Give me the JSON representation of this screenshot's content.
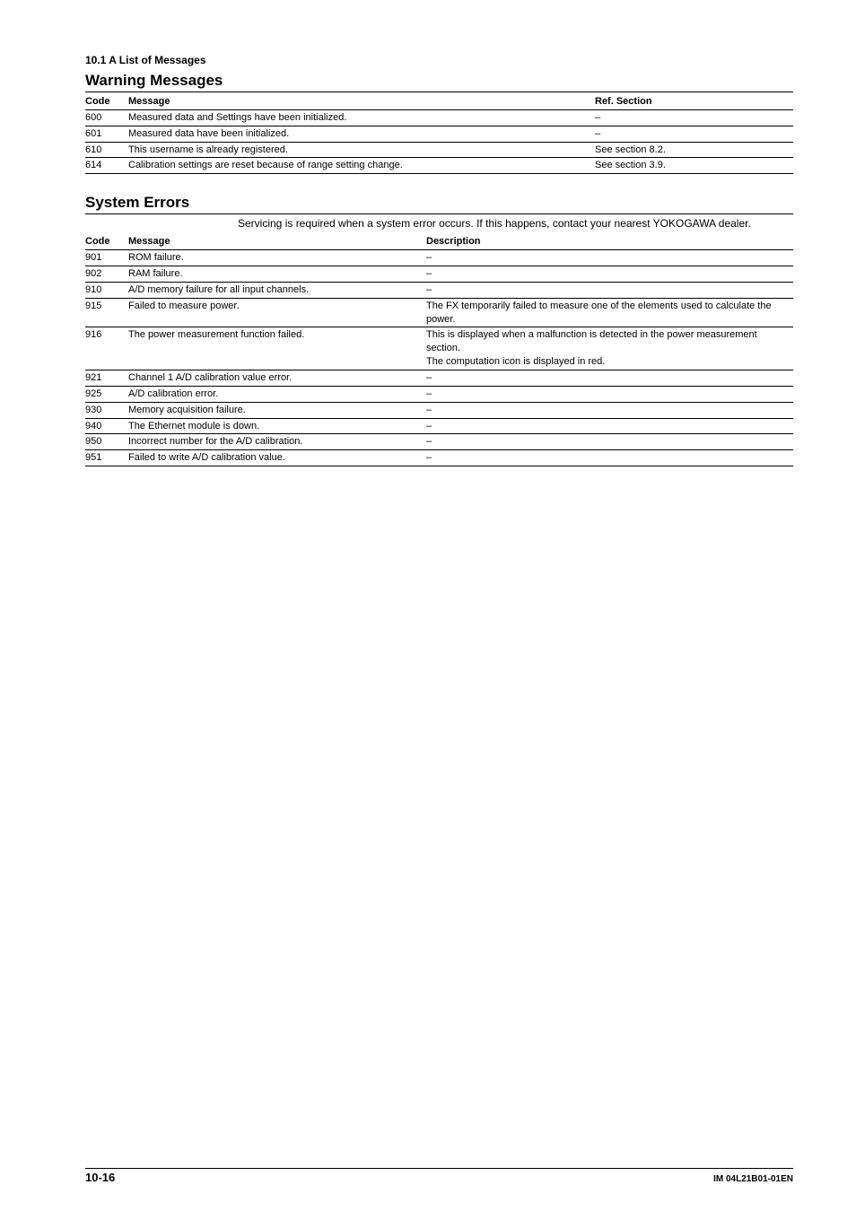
{
  "header": {
    "section_ref": "10.1  A List of Messages"
  },
  "warning": {
    "title": "Warning Messages",
    "headers": {
      "code": "Code",
      "message": "Message",
      "ref": "Ref. Section"
    },
    "rows": [
      {
        "code": "600",
        "message": "Measured data and Settings have been initialized.",
        "ref": "–"
      },
      {
        "code": "601",
        "message": "Measured data have been initialized.",
        "ref": "–"
      },
      {
        "code": "610",
        "message": "This username is already registered.",
        "ref": "See section 8.2."
      },
      {
        "code": "614",
        "message": "Calibration settings are reset because of range setting change.",
        "ref": "See section 3.9."
      }
    ]
  },
  "system": {
    "title": "System Errors",
    "intro": "Servicing is required when a system error occurs. If this happens, contact your nearest YOKOGAWA dealer.",
    "headers": {
      "code": "Code",
      "message": "Message",
      "desc": "Description"
    },
    "rows": [
      {
        "code": "901",
        "message": "ROM failure.",
        "desc": "–"
      },
      {
        "code": "902",
        "message": "RAM failure.",
        "desc": "–"
      },
      {
        "code": "910",
        "message": "A/D memory failure for all input channels.",
        "desc": "–"
      },
      {
        "code": "915",
        "message": "Failed to measure power.",
        "desc": "The FX temporarily failed to measure one of the elements used to calculate the power."
      },
      {
        "code": "916",
        "message": "The power measurement function failed.",
        "desc": "This is displayed when a malfunction is detected in the power measurement section.\nThe computation icon is displayed in red."
      },
      {
        "code": "921",
        "message": "Channel 1 A/D calibration value error.",
        "desc": "–"
      },
      {
        "code": "925",
        "message": "A/D calibration error.",
        "desc": "–"
      },
      {
        "code": "930",
        "message": "Memory acquisition failure.",
        "desc": "–"
      },
      {
        "code": "940",
        "message": "The Ethernet module is down.",
        "desc": "–"
      },
      {
        "code": "950",
        "message": "Incorrect number for the A/D calibration.",
        "desc": "–"
      },
      {
        "code": "951",
        "message": "Failed to write A/D calibration value.",
        "desc": "–"
      }
    ]
  },
  "footer": {
    "page": "10-16",
    "doc": "IM 04L21B01-01EN"
  }
}
